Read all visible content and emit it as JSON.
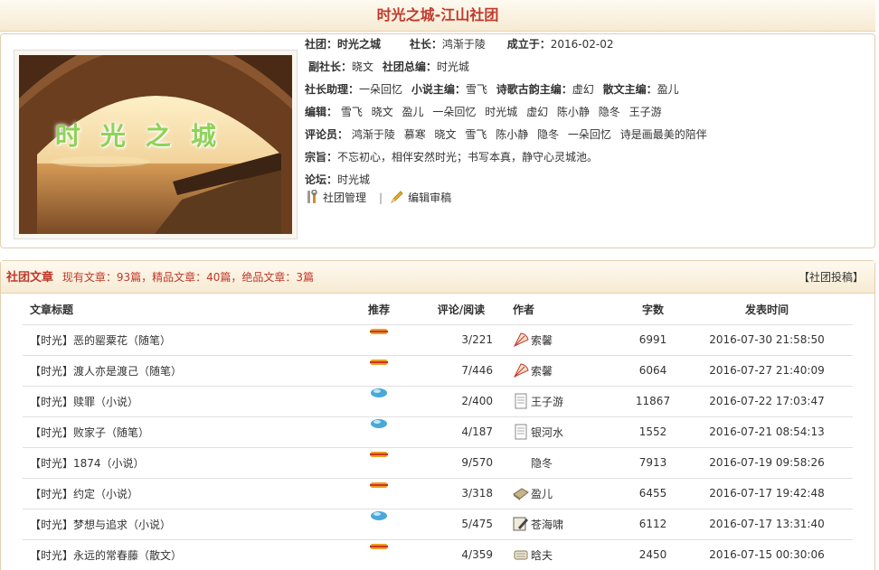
{
  "page_title": "时光之城-江山社团",
  "club": {
    "logo_text": "时光之城",
    "name_label": "社团：",
    "name": "时光之城",
    "president_label": "社长：",
    "president": "鸿渐于陵",
    "founded_label": "成立于：",
    "founded": "2016-02-02",
    "vice_president_label": "副社长：",
    "vice_president": "晓文",
    "chief_editor_label": "社团总编：",
    "chief_editor": "时光城",
    "assistant_label": "社长助理：",
    "assistant": "一朵回忆",
    "novel_editor_label": "小说主编：",
    "novel_editor": "雪飞",
    "poetry_editor_label": "诗歌古韵主编：",
    "poetry_editor": "虚幻",
    "prose_editor_label": "散文主编：",
    "prose_editor": "盈儿",
    "editors_label": "编辑：",
    "editors": [
      "雪飞",
      "晓文",
      "盈儿",
      "一朵回忆",
      "时光城",
      "虚幻",
      "陈小静",
      "隐冬",
      "王子游"
    ],
    "reviewers_label": "评论员：",
    "reviewers": [
      "鸿渐于陵",
      "慕寒",
      "晓文",
      "雪飞",
      "陈小静",
      "隐冬",
      "一朵回忆",
      "诗是画最美的陪伴"
    ],
    "motto_label": "宗旨：",
    "motto": "不忘初心，相伴安然时光；书写本真，静守心灵城池。",
    "forum_label": "论坛：",
    "forum": "时光城",
    "manage_label": "社团管理",
    "manage_sep": "|",
    "review_label": "编辑审稿"
  },
  "articles": {
    "heading": "社团文章",
    "stats": "现有文章：93篇，精品文章：40篇，绝品文章：3篇",
    "submit_label": "【社团投稿】",
    "columns": [
      "文章标题",
      "推荐",
      "评论/阅读",
      "作者",
      "字数",
      "发表时间"
    ],
    "rows": [
      {
        "title": "【时光】恶的罂粟花（随笔）",
        "rec": "red",
        "cr": "3/221",
        "author_icon": "fan",
        "author": "索馨",
        "words": "6991",
        "time": "2016-07-30 21:58:50"
      },
      {
        "title": "【时光】渡人亦是渡己（随笔）",
        "rec": "red",
        "cr": "7/446",
        "author_icon": "fan",
        "author": "索馨",
        "words": "6064",
        "time": "2016-07-27 21:40:09"
      },
      {
        "title": "【时光】赎罪（小说）",
        "rec": "blue",
        "cr": "2/400",
        "author_icon": "page",
        "author": "王子游",
        "words": "11867",
        "time": "2016-07-22 17:03:47"
      },
      {
        "title": "【时光】败家子（随笔）",
        "rec": "blue",
        "cr": "4/187",
        "author_icon": "page",
        "author": "银河水",
        "words": "1552",
        "time": "2016-07-21 08:54:13"
      },
      {
        "title": "【时光】1874（小说）",
        "rec": "red",
        "cr": "9/570",
        "author_icon": "none",
        "author": "隐冬",
        "words": "7913",
        "time": "2016-07-19 09:58:26"
      },
      {
        "title": "【时光】约定（小说）",
        "rec": "red",
        "cr": "3/318",
        "author_icon": "book",
        "author": "盈儿",
        "words": "6455",
        "time": "2016-07-17 19:42:48"
      },
      {
        "title": "【时光】梦想与追求（小说）",
        "rec": "blue",
        "cr": "5/475",
        "author_icon": "pen",
        "author": "苍海啸",
        "words": "6112",
        "time": "2016-07-17 13:31:40"
      },
      {
        "title": "【时光】永远的常春藤（散文）",
        "rec": "red",
        "cr": "4/359",
        "author_icon": "scroll",
        "author": "晗夫",
        "words": "2450",
        "time": "2016-07-15 00:30:06"
      }
    ]
  },
  "colors": {
    "accent_red": "#c0392b",
    "header_bg": "#f6ead2",
    "border": "#e2cfae"
  }
}
